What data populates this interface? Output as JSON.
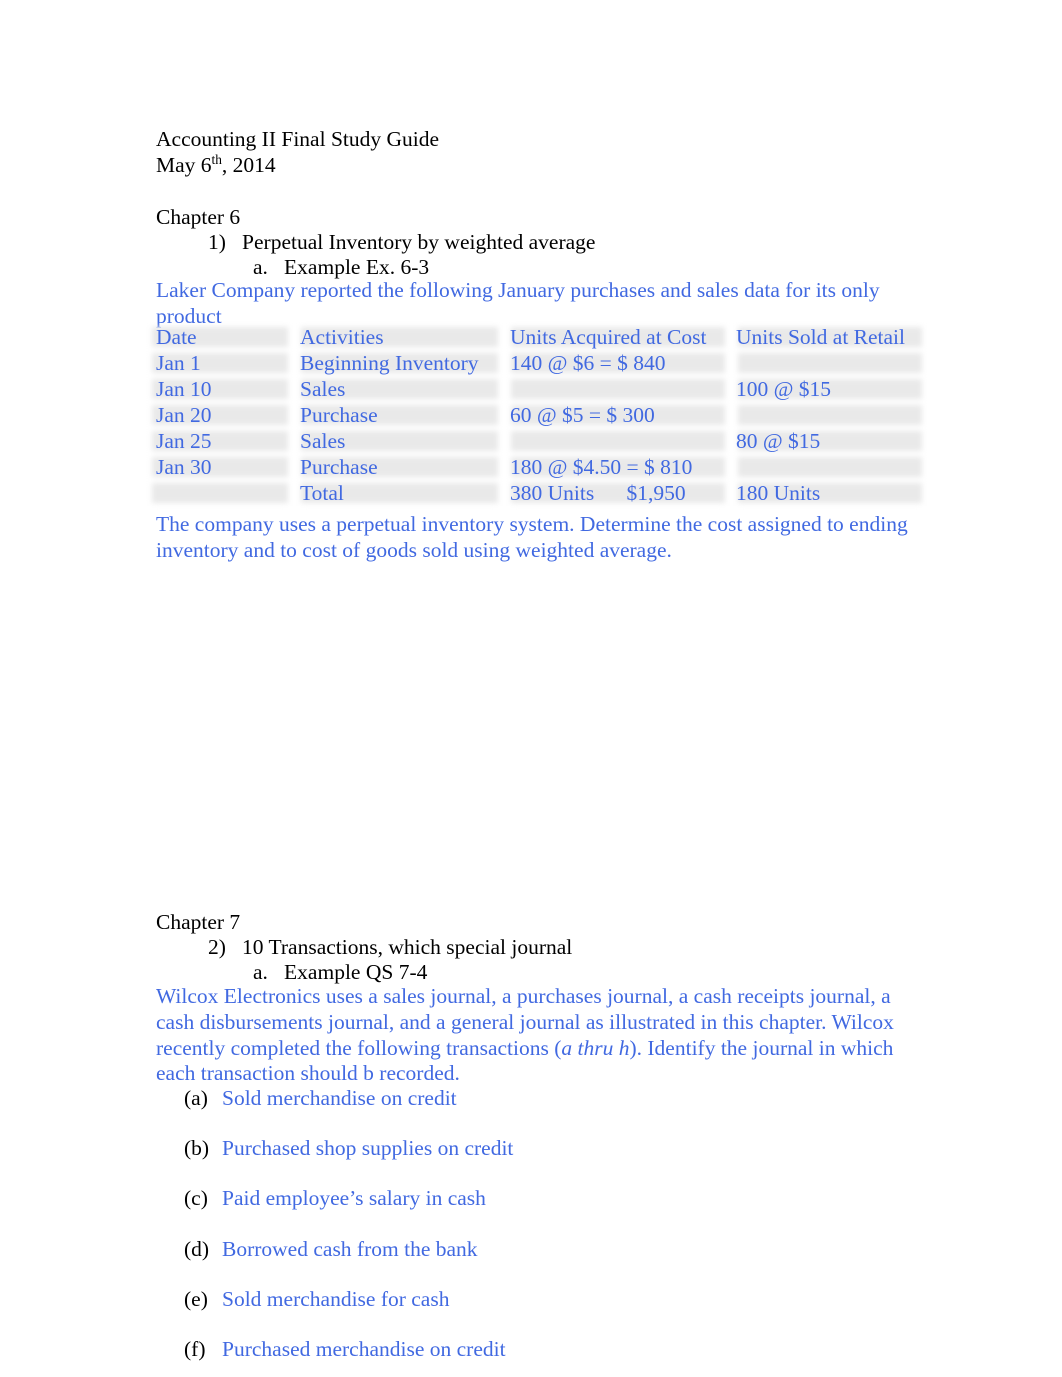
{
  "document": {
    "title": "Accounting II Final Study Guide",
    "date_prefix": "May 6",
    "date_ordinal": "th",
    "date_suffix": ", 2014"
  },
  "chapter6": {
    "heading": "Chapter 6",
    "item1": "1)   Perpetual Inventory by weighted average",
    "item1a": "a.   Example Ex. 6-3",
    "intro": "Laker Company reported the following January purchases and sales data for its only product",
    "outro": "The company uses a perpetual inventory system. Determine the cost assigned to ending inventory and to cost of goods sold using weighted average."
  },
  "inventory_table": {
    "headers": {
      "date": "Date",
      "activities": "Activities",
      "acquired": "Units Acquired at Cost",
      "sold": "Units Sold at Retail"
    },
    "rows": [
      {
        "date": "Jan 1",
        "activities": "Beginning Inventory",
        "acquired": "140 @ $6 = $ 840",
        "sold": ""
      },
      {
        "date": "Jan 10",
        "activities": "Sales",
        "acquired": "",
        "sold": "100 @ $15"
      },
      {
        "date": "Jan 20",
        "activities": "Purchase",
        "acquired": "60 @ $5 = $ 300",
        "sold": ""
      },
      {
        "date": "Jan 25",
        "activities": "Sales",
        "acquired": "",
        "sold": "80 @ $15"
      },
      {
        "date": "Jan 30",
        "activities": "Purchase",
        "acquired": "180 @ $4.50 = $ 810",
        "sold": ""
      },
      {
        "date": "",
        "activities": "Total",
        "acquired": "380 Units      $1,950",
        "sold": "180 Units"
      }
    ]
  },
  "chapter7": {
    "heading": "Chapter 7",
    "item2": "2)   10 Transactions, which special journal",
    "item2a": "a.   Example QS 7-4",
    "intro_part1": "Wilcox Electronics uses a sales journal, a purchases journal, a cash receipts journal, a cash disbursements journal, and a general journal as illustrated in this chapter. Wilcox recently completed the following transactions (",
    "intro_italic": "a thru h",
    "intro_part2": "). Identify the journal in which each transaction should b recorded."
  },
  "transactions": [
    {
      "marker": "(a)",
      "text": "Sold merchandise on credit"
    },
    {
      "marker": "(b)",
      "text": "Purchased shop supplies on credit"
    },
    {
      "marker": "(c)",
      "text": "Paid employee’s salary in cash"
    },
    {
      "marker": "(d)",
      "text": "Borrowed cash from the bank"
    },
    {
      "marker": "(e)",
      "text": "Sold merchandise for cash"
    },
    {
      "marker": "(f)",
      "text": "Purchased merchandise on credit"
    }
  ],
  "colors": {
    "body_text": "#000000",
    "highlight_blue": "#4169e1",
    "table_band": "#e9e9e9",
    "page_background": "#ffffff"
  }
}
